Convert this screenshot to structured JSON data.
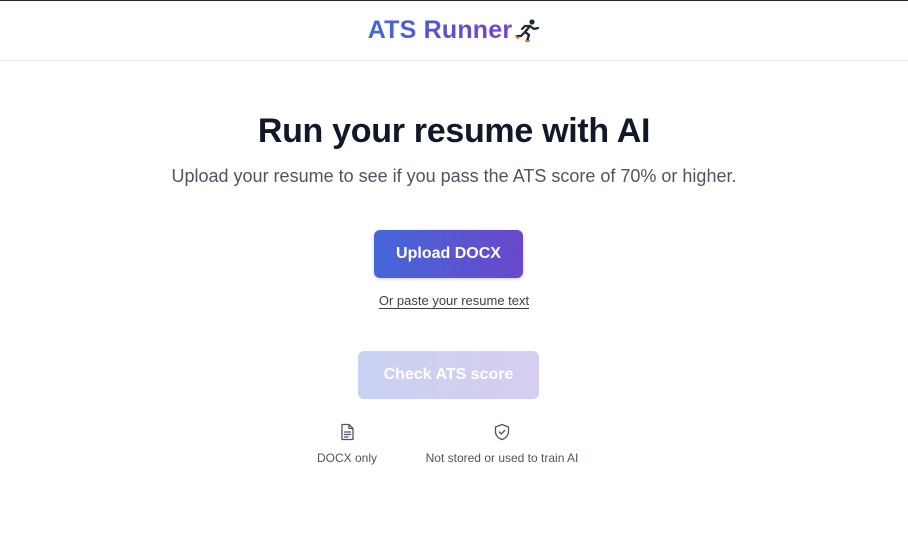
{
  "header": {
    "logo_text": "ATS Runner",
    "logo_icon": "running-person-icon",
    "brand_gradient": [
      "#4469d8",
      "#7444c9"
    ]
  },
  "hero": {
    "title": "Run your resume with AI",
    "subtitle": "Upload your resume to see if you pass the ATS score of 70% or higher."
  },
  "actions": {
    "upload_label": "Upload DOCX",
    "paste_label": "Or paste your resume text",
    "check_label": "Check ATS score",
    "check_disabled": true
  },
  "features": [
    {
      "icon": "document-icon",
      "label": "DOCX only"
    },
    {
      "icon": "shield-check-icon",
      "label": "Not stored or used to train AI"
    }
  ]
}
